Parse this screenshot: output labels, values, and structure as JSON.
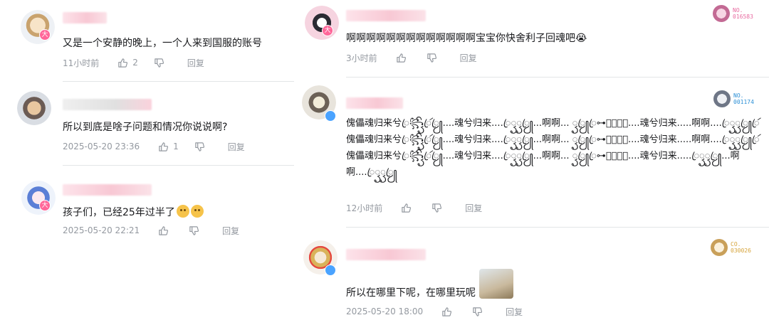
{
  "left_comments": [
    {
      "text": "又是一个安静的晚上，一个人来到国服的账号",
      "time": "11小时前",
      "likes": "2",
      "reply_label": "回复",
      "badge": "大"
    },
    {
      "text": "所以到底是啥子问题和情况你说说啊?",
      "time": "2025-05-20 23:36",
      "likes": "1",
      "reply_label": "回复"
    },
    {
      "text": "孩子们，已经25年过半了",
      "time": "2025-05-20 22:21",
      "likes": "",
      "reply_label": "回复",
      "badge": "大"
    }
  ],
  "right_comments": [
    {
      "text": "啊啊啊啊啊啊啊啊啊啊啊啊啊宝宝你快舍利子回魂吧😭",
      "time": "3小时前",
      "reply_label": "回复",
      "fan_badge": {
        "label": "NO.",
        "number": "016583",
        "color": "#e86aa0"
      },
      "badge": "大"
    },
    {
      "text": "傀儡魂归来兮ꦿ꧂ꦽꦼꦿꦂꦿꦾ....魂兮归来....ꦿꦽꦽꦿꦾ...啊啊... ꦽꦿꦾꦿ⊶ꦽꦾꦿꦾ....魂兮归来.....啊啊....ꦿꦽꦽꦿꦾꦿꦂ傀儡魂归来兮ꦿ꧂ꦽꦼꦿꦂꦿꦾ....魂兮归来....ꦿꦽꦽꦿꦾ...啊啊... ꦽꦿꦾꦿ⊶ꦽꦾꦿꦾ....魂兮归来.....啊啊....ꦿꦽꦽꦿꦾꦿꦂ傀儡魂归来兮ꦿ꧂ꦽꦼꦿꦂꦿꦾ....魂兮归来....ꦿꦽꦽꦿꦾ...啊啊... ꦽꦿꦾꦿ⊶ꦽꦾꦿꦾ....魂兮归来.....ꦿꦽꦽꦿꦾ...啊啊....ꦿꦽꦽꦿꦾ",
      "time": "12小时前",
      "reply_label": "回复",
      "fan_badge": {
        "label": "NO.",
        "number": "001174",
        "color": "#2a8fd6"
      }
    },
    {
      "text": "所以在哪里下呢，在哪里玩呢",
      "time": "2025-05-20 18:00",
      "reply_label": "回复",
      "fan_badge": {
        "label": "CO.",
        "number": "030026",
        "color": "#d6a43a"
      }
    }
  ],
  "icons": {
    "like": "thumbs-up-icon",
    "dislike": "thumbs-down-icon",
    "sticker": "anime-girl-sticker"
  },
  "colors": {
    "meta_text": "#9499a0",
    "divider": "#e3e5e7",
    "level_badge": "#ff6699"
  }
}
